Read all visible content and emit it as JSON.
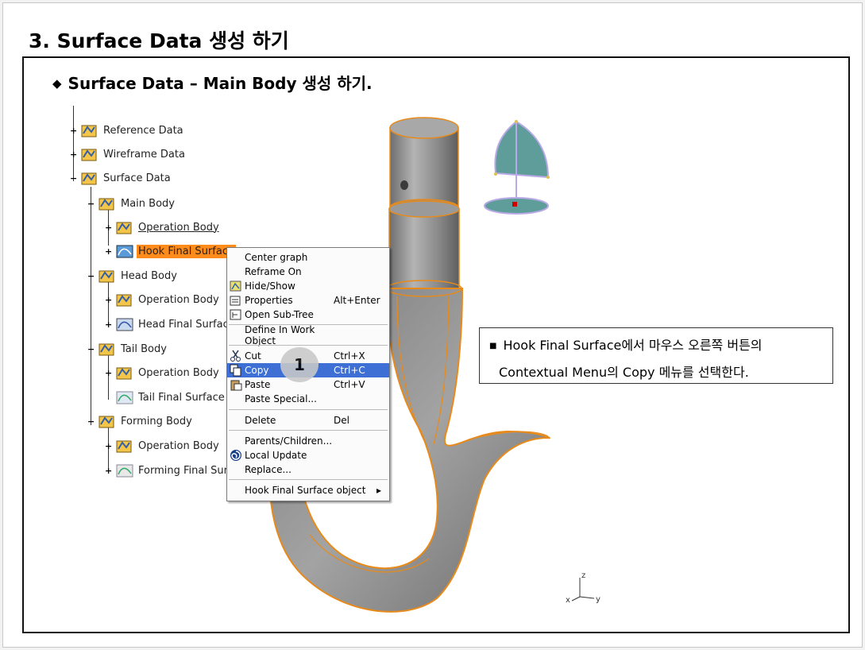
{
  "slide": {
    "title": "3. Surface Data 생성 하기",
    "subtitle": "Surface Data – Main Body 생성 하기."
  },
  "tree": {
    "items": [
      {
        "label": "Reference Data",
        "icon": "geometry-set-icon"
      },
      {
        "label": "Wireframe Data",
        "icon": "geometry-set-icon"
      },
      {
        "label": "Surface Data",
        "icon": "geometry-set-icon"
      },
      {
        "label": "Main Body",
        "icon": "geometry-set-icon"
      },
      {
        "label": "Operation Body",
        "icon": "geometry-set-icon"
      },
      {
        "label": "Hook Final Surface",
        "icon": "surface-icon"
      },
      {
        "label": "Head Body",
        "icon": "geometry-set-icon"
      },
      {
        "label": "Operation Body",
        "icon": "geometry-set-icon"
      },
      {
        "label": "Head Final Surface",
        "icon": "surface-icon"
      },
      {
        "label": "Tail Body",
        "icon": "geometry-set-icon"
      },
      {
        "label": "Operation Body",
        "icon": "geometry-set-icon"
      },
      {
        "label": "Tail Final Surface",
        "icon": "surface-icon"
      },
      {
        "label": "Forming Body",
        "icon": "geometry-set-icon"
      },
      {
        "label": "Operation Body",
        "icon": "geometry-set-icon"
      },
      {
        "label": "Forming Final Surf",
        "icon": "surface-icon"
      }
    ]
  },
  "context_menu": {
    "items": [
      {
        "label": "Center graph",
        "shortcut": ""
      },
      {
        "label": "Reframe On",
        "shortcut": ""
      },
      {
        "label": "Hide/Show",
        "shortcut": ""
      },
      {
        "label": "Properties",
        "shortcut": "Alt+Enter"
      },
      {
        "label": "Open Sub-Tree",
        "shortcut": ""
      },
      {
        "label": "Define In Work Object",
        "shortcut": ""
      },
      {
        "label": "Cut",
        "shortcut": "Ctrl+X"
      },
      {
        "label": "Copy",
        "shortcut": "Ctrl+C"
      },
      {
        "label": "Paste",
        "shortcut": "Ctrl+V"
      },
      {
        "label": "Paste Special...",
        "shortcut": ""
      },
      {
        "label": "Delete",
        "shortcut": "Del"
      },
      {
        "label": "Parents/Children...",
        "shortcut": ""
      },
      {
        "label": "Local Update",
        "shortcut": ""
      },
      {
        "label": "Replace...",
        "shortcut": ""
      },
      {
        "label": "Hook Final Surface object",
        "shortcut": ""
      }
    ],
    "highlighted": "Copy"
  },
  "step_badge": "1",
  "callout": {
    "line1": "Hook Final Surface에서 마우스 오른쪽 버튼의",
    "line2": "Contextual Menu의 Copy 메뉴를 선택한다."
  },
  "axis": {
    "z": "z",
    "x": "x",
    "y": "y"
  },
  "colors": {
    "selection": "#ff8c1a",
    "menu_highlight": "#3d6fd4",
    "edge": "#e88a1a",
    "body": "#8c8c8c"
  }
}
